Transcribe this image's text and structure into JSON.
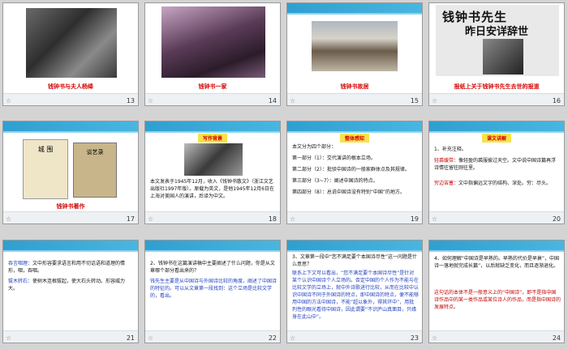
{
  "slides": [
    {
      "num": "13",
      "caption": "钱钟书与夫人杨绛"
    },
    {
      "num": "14",
      "caption": "钱钟书一家"
    },
    {
      "num": "15",
      "caption": "钱钟书故居"
    },
    {
      "num": "16",
      "headline_line1": "钱钟书先生",
      "headline_line2": "昨日安详辞世",
      "caption": "报纸上关于钱钟书先生去世的报道"
    },
    {
      "num": "17",
      "book1": "城 围",
      "book2": "谈艺录",
      "caption": "钱钟书著作"
    },
    {
      "num": "18",
      "tag": "写作背景",
      "text": "本文发表于1945年12月，收入《钱钟书散文》（浙江文艺出版社1997年版）。原载为英文，是他1945年12月6日在上海对美国人的演讲，后译为中文。"
    },
    {
      "num": "19",
      "tag": "整体感知",
      "intro": "本文分为四个部分：",
      "parts": [
        "第一部分（1）：交代演讲的根本立场。",
        "第二部分（2）：批驳中国诗的一般家群体点及其规律。",
        "第三部分（3~7）：阐述中国诗的特点。",
        "第四部分（8）：总说中国诗没有特别“中国”的地方。"
      ]
    },
    {
      "num": "20",
      "tag": "课文讲解",
      "head": "1、补充注释。",
      "items": [
        {
          "term": "轻裘缓带：",
          "desc": "像轻盈的裘服披过天空。文中说中国诗篇再浮诗情往留往刚往里。"
        },
        {
          "term": "穷边苦塞：",
          "desc": "文中指偏远文字的结构、深处。穷：尽头。"
        }
      ]
    },
    {
      "num": "21",
      "items": [
        {
          "term": "吞言咽理：",
          "desc": "文中形容要求语言和用不切话语和道理的情形，咽，吞咽。"
        },
        {
          "term": "拔木转石：",
          "desc": "使树木连根拔起，使大石头转动。形容威力大。"
        }
      ]
    },
    {
      "num": "22",
      "text": "2、钱钟书在这篇演讲稿中主要阐述了什么问题，你是从文章哪个部分看出来的？",
      "answer": "钱先生主要是从中国诗与外国诗比较的角度，阐述了中国诗的特征的。可以从文章第一段找到：这个立场是比较文学的，看出。"
    },
    {
      "num": "23",
      "question": "3、文章第一段中“您不满足要个本国诗尽性”这一问题是什么意思？",
      "text": "联系上下文可以看出，“您不满足要个本国诗尽性”是针对某个认识中国诗个人立场的。否定中国的个人作为不能与在比较文学的立场上，就中外诗歌进行比较，从而在比较中认识中国诗不同于外国诗的特点，即中国诗的特点，便不能够用中国的方法中国诗，不能“超以象外，得其环中”，用批判性的眼光看待中国诗，因此谓要“不识庐山真面目，只缘身在此山中”。"
    },
    {
      "num": "24",
      "question": "4、如何理解“中国诗是早熟的。早熟的代价是早衰”，中国诗一落地就完成长篇”，以后就缺乏变化，而且逐渐退化。",
      "answer": "这句话的本体不是一般意义上的“中国诗”，即不是指中国诗作品中的某一类作品或某位诗人的作品，而是指中国诗的发展特点。"
    }
  ]
}
